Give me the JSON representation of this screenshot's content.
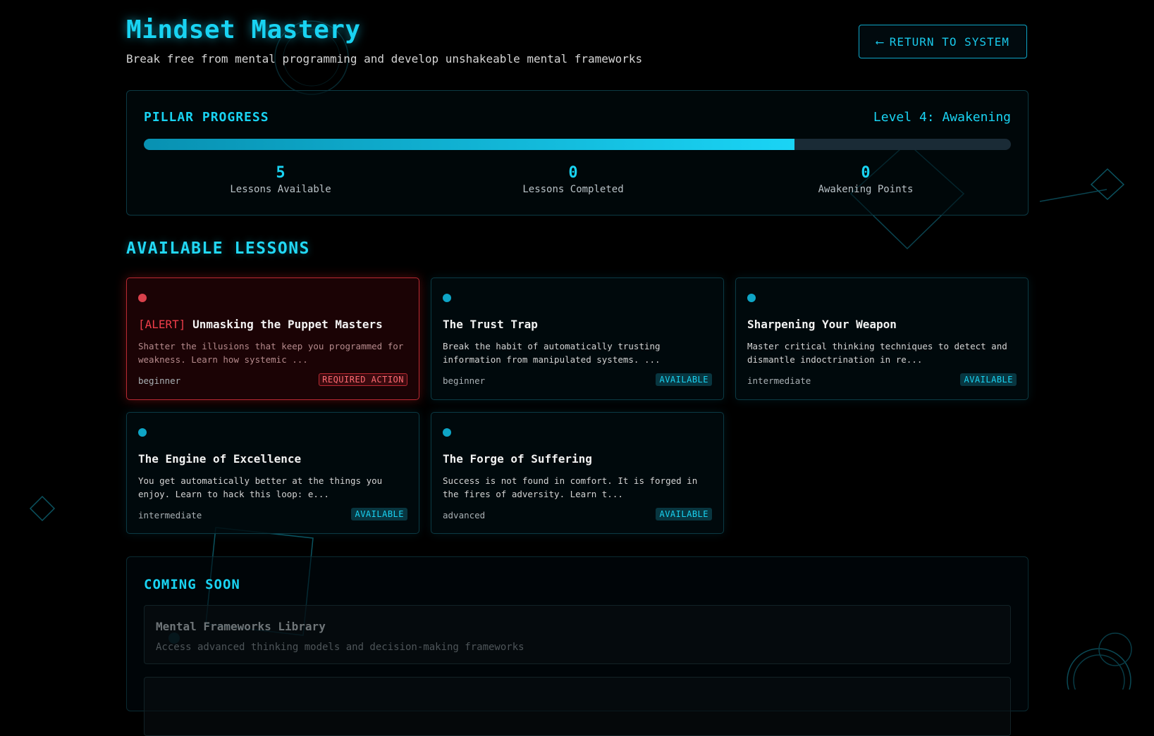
{
  "header": {
    "title": "Mindset Mastery",
    "subtitle": "Break free from mental programming and develop unshakeable mental frameworks",
    "return_button": {
      "arrow": "⟵",
      "label": "RETURN TO SYSTEM",
      "icon": "arrow-left-icon"
    }
  },
  "progress": {
    "title": "PILLAR PROGRESS",
    "level": "Level 4: Awakening",
    "percent": 75,
    "stats": [
      {
        "value": "5",
        "label": "Lessons Available"
      },
      {
        "value": "0",
        "label": "Lessons Completed"
      },
      {
        "value": "0",
        "label": "Awakening Points"
      }
    ]
  },
  "lessons": {
    "title": "AVAILABLE LESSONS",
    "items": [
      {
        "alert_tag": "[ALERT]",
        "title": "Unmasking the Puppet Masters",
        "description": "Shatter the illusions that keep you programmed for weakness. Learn how systemic ...",
        "level": "beginner",
        "badge": "REQUIRED ACTION"
      },
      {
        "title": "The Trust Trap",
        "description": "Break the habit of automatically trusting information from manipulated systems. ...",
        "level": "beginner",
        "badge": "AVAILABLE"
      },
      {
        "title": "Sharpening Your Weapon",
        "description": "Master critical thinking techniques to detect and dismantle indoctrination in re...",
        "level": "intermediate",
        "badge": "AVAILABLE"
      },
      {
        "title": "The Engine of Excellence",
        "description": "You get automatically better at the things you enjoy. Learn to hack this loop: e...",
        "level": "intermediate",
        "badge": "AVAILABLE"
      },
      {
        "title": "The Forge of Suffering",
        "description": "Success is not found in comfort. It is forged in the fires of adversity. Learn t...",
        "level": "advanced",
        "badge": "AVAILABLE"
      }
    ]
  },
  "coming_soon": {
    "title": "COMING SOON",
    "items": [
      {
        "title": "Mental Frameworks Library",
        "description": "Access advanced thinking models and decision-making frameworks"
      }
    ]
  },
  "colors": {
    "accent": "#19d3f2",
    "alert": "#ef3e4a",
    "background": "#000000"
  }
}
